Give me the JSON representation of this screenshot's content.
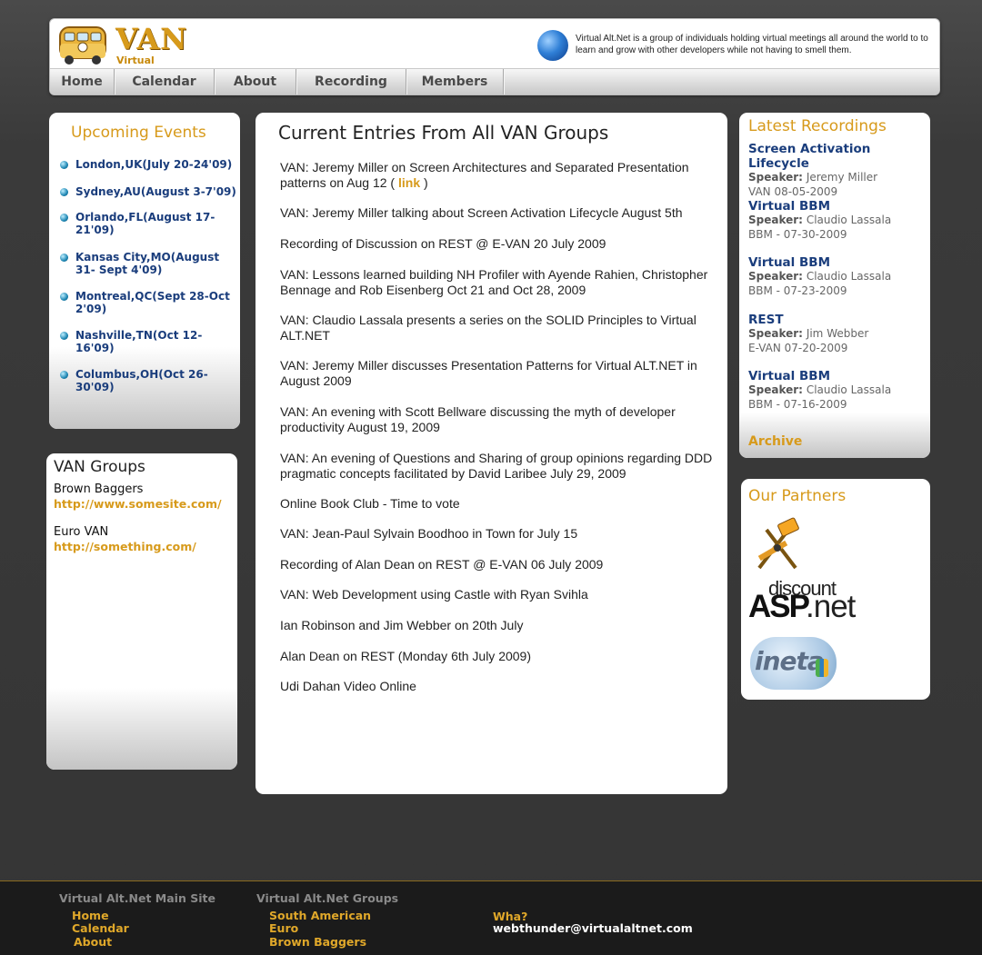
{
  "header": {
    "logo_text": "VAN",
    "logo_sub": "Virtual Alt.Net",
    "tagline": "Virtual Alt.Net is a group of individuals holding virtual meetings all around the world to to learn and grow with other developers while not having to smell them.",
    "nav": [
      {
        "label": "Home"
      },
      {
        "label": "Calendar"
      },
      {
        "label": "About"
      },
      {
        "label": "Recording"
      },
      {
        "label": "Members"
      }
    ]
  },
  "events": {
    "title": "Upcoming Events",
    "items": [
      "London,UK(July 20-24'09)",
      "Sydney,AU(August 3-7'09)",
      "Orlando,FL(August 17-21'09)",
      "Kansas City,MO(August 31- Sept 4'09)",
      "Montreal,QC(Sept 28-Oct 2'09)",
      "Nashville,TN(Oct 12-16'09)",
      "Columbus,OH(Oct 26-30'09)"
    ]
  },
  "groups": {
    "title": "VAN Groups",
    "items": [
      {
        "name": "Brown Baggers",
        "url": "http://www.somesite.com/"
      },
      {
        "name": "Euro VAN",
        "url": "http://something.com/"
      }
    ]
  },
  "main": {
    "title": "Current Entries From All VAN Groups",
    "first_entry": {
      "text": "VAN: Jeremy Miller on Screen Architectures and Separated Presentation patterns on Aug 12 ( ",
      "link": "link",
      "after": " )"
    },
    "entries": [
      "VAN: Jeremy Miller talking about Screen Activation Lifecycle August 5th",
      "Recording of Discussion on REST @ E-VAN 20 July 2009",
      "VAN: Lessons learned building NH Profiler with Ayende Rahien, Christopher Bennage and Rob Eisenberg Oct 21 and Oct 28, 2009",
      "VAN: Claudio Lassala presents a series on the SOLID Principles to Virtual ALT.NET",
      "VAN: Jeremy Miller discusses Presentation Patterns for Virtual ALT.NET in August 2009",
      "VAN: An evening with Scott Bellware discussing the myth of developer productivity August 19, 2009",
      "VAN: An evening of Questions and Sharing of group opinions regarding DDD pragmatic concepts facilitated by David Laribee July 29, 2009",
      "Online Book Club - Time to vote",
      "VAN: Jean-Paul Sylvain Boodhoo in Town for July 15",
      "Recording of Alan Dean on REST @ E-VAN 06 July 2009",
      "VAN: Web Development using Castle with Ryan Svihla",
      "Ian Robinson and Jim Webber on 20th July",
      "Alan Dean on REST (Monday 6th July 2009)",
      "Udi Dahan Video Online"
    ]
  },
  "recordings": {
    "title": "Latest Recordings",
    "speaker_label": "Speaker:",
    "items": [
      {
        "title": "Screen Activation Lifecycle",
        "speaker": "Jeremy Miller",
        "meta": "VAN 08-05-2009"
      },
      {
        "title": "Virtual BBM",
        "speaker": "Claudio Lassala",
        "meta": "BBM - 07-30-2009"
      },
      {
        "title": "Virtual BBM",
        "speaker": "Claudio Lassala",
        "meta": "BBM - 07-23-2009"
      },
      {
        "title": "REST",
        "speaker": "Jim Webber",
        "meta": "E-VAN 07-20-2009"
      },
      {
        "title": "Virtual BBM",
        "speaker": "Claudio Lassala",
        "meta": "BBM - 07-16-2009"
      }
    ],
    "archive": "Archive"
  },
  "partners": {
    "title": "Our Partners",
    "discount_top": "discount",
    "discount_asp": "ASP",
    "discount_net": ".net",
    "ineta": "ineta"
  },
  "footer": {
    "col1_title": "Virtual Alt.Net Main Site",
    "col1_links": [
      "Home",
      "Calendar",
      "About"
    ],
    "col2_title": "Virtual Alt.Net Groups",
    "col2_links": [
      "South American",
      "Euro",
      "Brown Baggers"
    ],
    "col3_title": "Wha?",
    "email": "webthunder@virtualaltnet.com"
  },
  "colors": {
    "accent": "#d79a1b",
    "link_blue": "#1a3d7c",
    "background": "#3a3a3a"
  }
}
